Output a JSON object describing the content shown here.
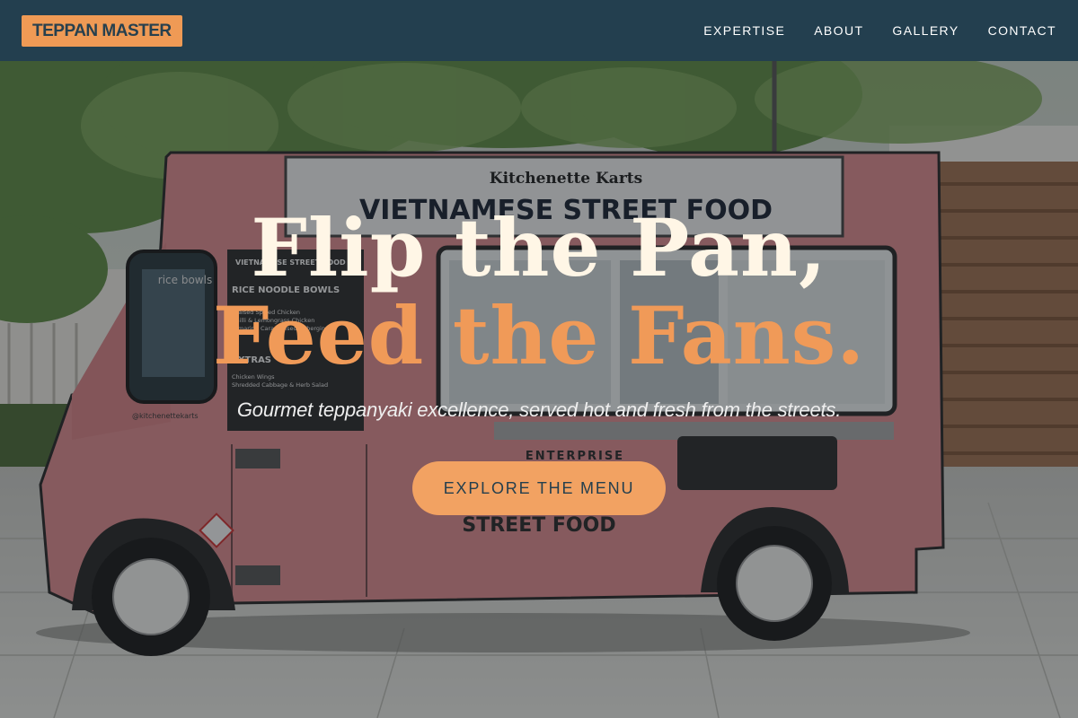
{
  "header": {
    "logo": "TEPPAN MASTER",
    "nav": [
      "EXPERTISE",
      "ABOUT",
      "GALLERY",
      "CONTACT"
    ]
  },
  "scene": {
    "truck_brand": "Kitchenette Karts",
    "truck_banner": "VIETNAMESE STREET FOOD",
    "menu_title": "VIETNAMESE STREET FOOD",
    "menu_section_1": "RICE NOODLE BOWLS",
    "menu_items_1": [
      "Braised Spiced Chicken",
      "Chilli & Lemongrass Chicken",
      "Tamarind Caramelised Aubergine"
    ],
    "menu_section_2": "EXTRAS",
    "menu_items_2": [
      "Chicken Wings",
      "Shredded Cabbage & Herb Salad"
    ],
    "menu_handle": "@kitchenettekarts",
    "window_sign": "rice bowls",
    "side_text_1": "ENTERPRISE",
    "side_text_2": "STREET FOOD"
  },
  "hero": {
    "headline_line1": "Flip the Pan,",
    "headline_line2": "Feed the Fans.",
    "subtitle": "Gourmet teppanyaki excellence, served hot and fresh from the streets.",
    "cta_label": "EXPLORE THE MENU"
  },
  "colors": {
    "header_bg": "#233f4f",
    "accent": "#f09a58",
    "headline_light": "#fff6e6",
    "truck_pink": "#d98a8d"
  }
}
